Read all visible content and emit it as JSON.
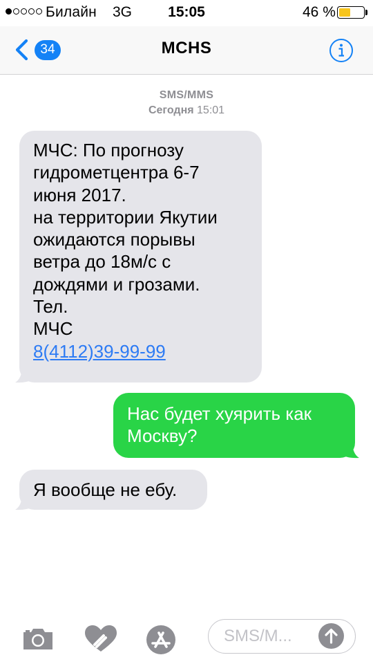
{
  "status_bar": {
    "signal_dots_filled": 1,
    "signal_dots_total": 5,
    "carrier": "Билайн",
    "network": "3G",
    "time": "15:05",
    "battery_percent_label": "46 %",
    "battery_level": 0.46,
    "battery_color": "#f7c51d"
  },
  "nav": {
    "back_badge": "34",
    "title": "MCHS",
    "accent_color": "#1482f6"
  },
  "conversation": {
    "meta_type": "SMS/MMS",
    "meta_day": "Сегодня",
    "meta_time": "15:01"
  },
  "messages": [
    {
      "direction": "incoming",
      "lines": [
        "МЧС: По прогнозу",
        "гидрометцентра 6-7",
        "июня 2017.",
        "на территории Якутии",
        "ожидаются порывы",
        "ветра до 18м/с с",
        "дождями и грозами.",
        "Тел.",
        "МЧС"
      ],
      "link": "8(4112)39-99-99"
    },
    {
      "direction": "outgoing",
      "lines": [
        "Нас будет хуярить как",
        "Москву?"
      ]
    },
    {
      "direction": "incoming",
      "lines": [
        "Я вообще не ебу."
      ]
    }
  ],
  "input_bar": {
    "icons": [
      "camera-icon",
      "digital-touch-heart-icon",
      "app-store-icon"
    ],
    "placeholder": "SMS/M...",
    "send_icon": "arrow-up-icon"
  },
  "colors": {
    "incoming_bubble": "#e5e5ea",
    "outgoing_bubble": "#29d447",
    "link": "#2d7bf4"
  }
}
